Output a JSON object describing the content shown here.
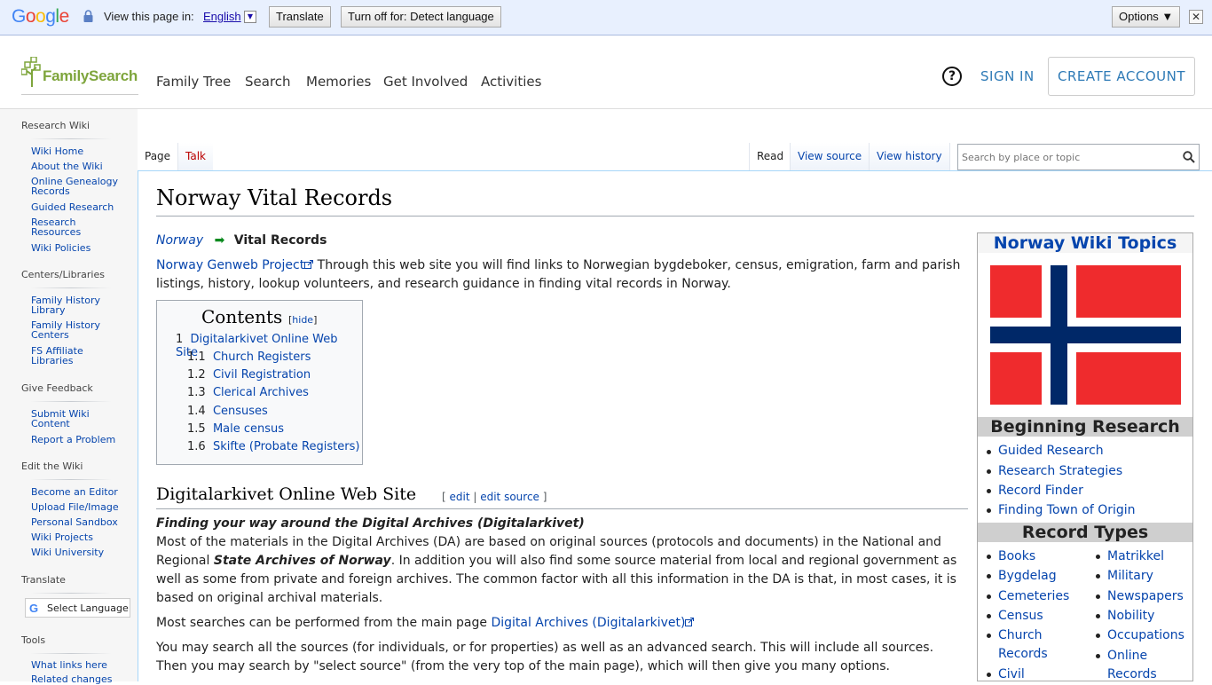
{
  "google_bar": {
    "logo": "Google",
    "view_in": "View this page in:",
    "language": "English",
    "translate_btn": "Translate",
    "turn_off_btn": "Turn off for: Detect language",
    "options_btn": "Options ▼",
    "close": "✕"
  },
  "header": {
    "logo_text": "FamilySearch",
    "nav": [
      "Family Tree",
      "Search",
      "Memories",
      "Get Involved",
      "Activities"
    ],
    "help": "?",
    "sign_in": "SIGN IN",
    "create_account": "CREATE ACCOUNT"
  },
  "sidebar": {
    "sections": [
      {
        "heading": "Research Wiki",
        "items": [
          "Wiki Home",
          "About the Wiki",
          "Online Genealogy Records",
          "Guided Research",
          "Research Resources",
          "Wiki Policies"
        ]
      },
      {
        "heading": "Centers/Libraries",
        "items": [
          "Family History Library",
          "Family History Centers",
          "FS Affiliate Libraries"
        ]
      },
      {
        "heading": "Give Feedback",
        "items": [
          "Submit Wiki Content",
          "Report a Problem"
        ]
      },
      {
        "heading": "Edit the Wiki",
        "items": [
          "Become an Editor",
          "Upload File/Image",
          "Personal Sandbox",
          "Wiki Projects",
          "Wiki University"
        ]
      },
      {
        "heading": "Translate",
        "items": []
      },
      {
        "heading": "Tools",
        "items": [
          "What links here",
          "Related changes"
        ]
      }
    ],
    "translate_widget": {
      "g": "G",
      "label": "Select Language"
    }
  },
  "tabs": {
    "page": "Page",
    "talk": "Talk",
    "read": "Read",
    "view_source": "View source",
    "view_history": "View history"
  },
  "search": {
    "placeholder": "Search by place or topic"
  },
  "article": {
    "title": "Norway Vital Records",
    "breadcrumb_parent": "Norway",
    "breadcrumb_arrow": "➡",
    "breadcrumb_current": "Vital Records",
    "intro_link": "Norway Genweb Project",
    "intro_text_1": " Through this web site you will find links to Norwegian bygdeboker, census, emigration, farm and parish",
    "intro_text_2": "listings, history, lookup volunteers, and research guidance in finding vital records in Norway.",
    "toc": {
      "title": "Contents",
      "hide": "hide",
      "items": [
        {
          "num": "1",
          "label": "Digitalarkivet Online Web Site"
        },
        {
          "num": "1.1",
          "label": "Church Registers"
        },
        {
          "num": "1.2",
          "label": "Civil Registration"
        },
        {
          "num": "1.3",
          "label": "Clerical Archives"
        },
        {
          "num": "1.4",
          "label": "Censuses"
        },
        {
          "num": "1.5",
          "label": "Male census"
        },
        {
          "num": "1.6",
          "label": "Skifte (Probate Registers)"
        }
      ]
    },
    "section1": {
      "heading": "Digitalarkivet Online Web Site",
      "edit": "edit",
      "edit_source": "edit source",
      "subheading": "Finding your way around the Digital Archives  (Digitalarkivet)",
      "p1_line1": "Most of the materials in the Digital Archives (DA) are based on original sources (protocols and documents) in the National and",
      "p1_line2_a": "Regional ",
      "p1_line2_b": "State Archives of Norway",
      "p1_line2_c": ". In addition you will also find some source material from local and regional government as",
      "p1_line3": "well as some from private and foreign archives. The common factor with all this information in the DA is that, in most cases, it is",
      "p1_line4": "based on original archival materials.",
      "p2_text": "Most searches can be performed from the main page ",
      "p2_link": "Digital Archives (Digitalarkivet)",
      "p3_line1": "You may search all the sources (for individuals, or for properties) as well as an advanced search.  This will include all sources.",
      "p3_line2": "Then you may search by \"select source\" (from the very top of the main page), which will then give you many options."
    }
  },
  "infobox": {
    "title": "Norway Wiki Topics",
    "beginning": "Beginning Research",
    "beginning_links": [
      "Guided Research",
      "Research Strategies",
      "Record Finder",
      "Finding Town of Origin"
    ],
    "record_types": "Record Types",
    "col1": [
      "Books",
      "Bygdelag",
      "Cemeteries",
      "Census",
      "Church",
      "Records",
      "Civil"
    ],
    "col2": [
      "Matrikkel",
      "Military",
      "Newspapers",
      "Nobility",
      "Occupations",
      "Online",
      "Records"
    ]
  },
  "colors": {
    "link": "#0645ad",
    "fs_green": "#7ea53c",
    "fs_blue": "#2e7ab6",
    "flag_red": "#ef2b2d",
    "flag_blue": "#002868"
  }
}
